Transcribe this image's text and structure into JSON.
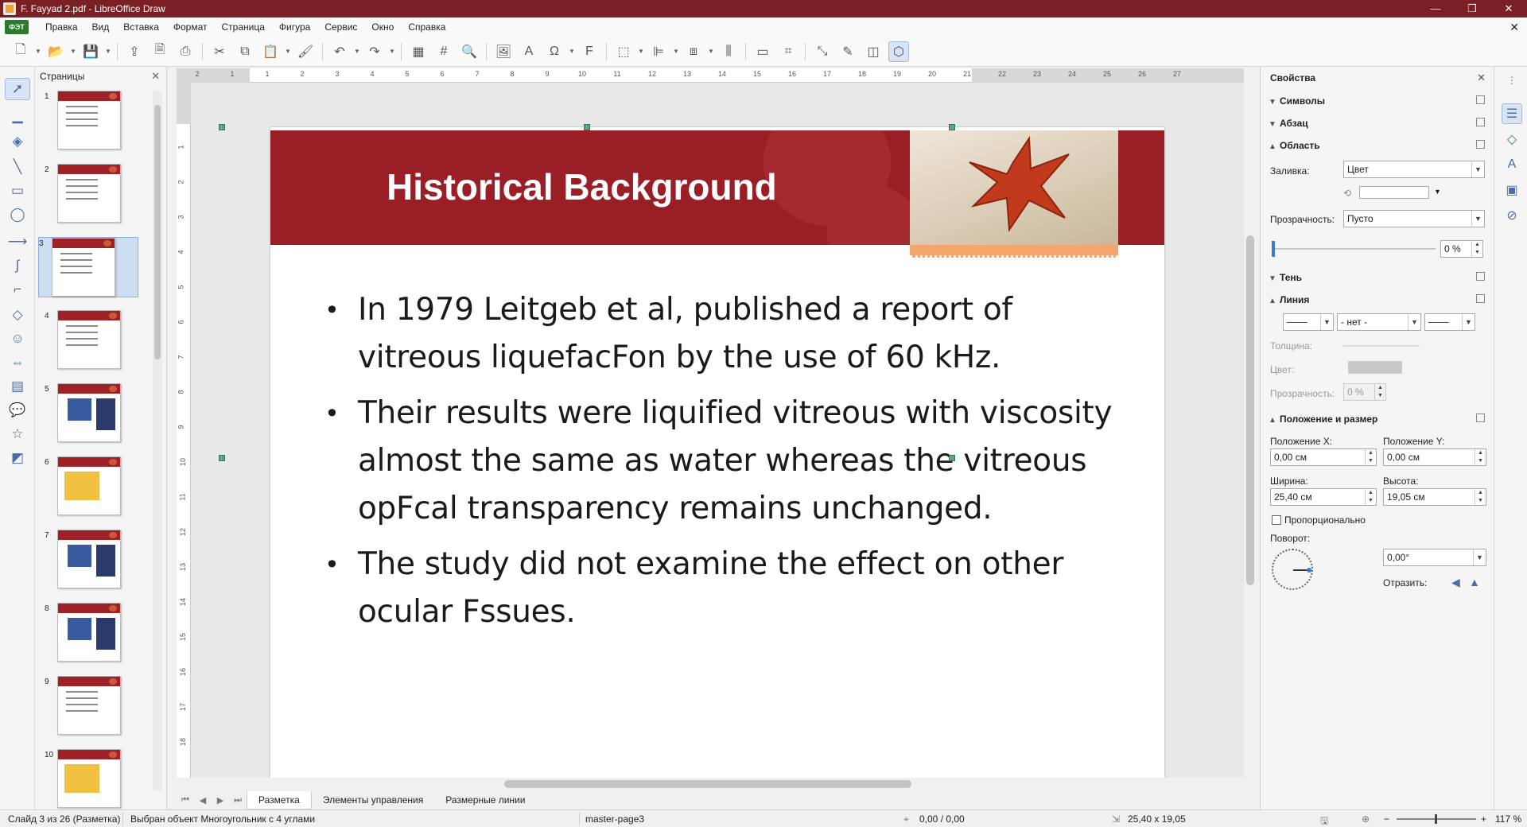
{
  "window": {
    "title": "F. Fayyad 2.pdf - LibreOffice Draw",
    "controls": [
      "—",
      "❐",
      "✕"
    ]
  },
  "menubar": {
    "logo": "ФЭТ",
    "items": [
      "Правка",
      "Вид",
      "Вставка",
      "Формат",
      "Страница",
      "Фигура",
      "Сервис",
      "Окно",
      "Справка"
    ],
    "close_doc": "✕"
  },
  "toolbar": {
    "icons": [
      "new-icon",
      "open-icon",
      "save-icon",
      "export-icon",
      "export-pdf-icon",
      "print-icon",
      "cut-icon",
      "copy-icon",
      "paste-icon",
      "clone-format-icon",
      "undo-icon",
      "redo-icon",
      "grid-icon",
      "helplines-icon",
      "zoom-icon",
      "image-icon",
      "textbox-icon",
      "special-char-icon",
      "fontwork-icon",
      "transform-icon",
      "align-icon",
      "arrange-icon",
      "distribute-icon",
      "shadow-icon",
      "crop-icon",
      "points-icon",
      "glue-icon",
      "toggle-extrusion-icon",
      "show-draw-icon"
    ]
  },
  "slides_pane": {
    "title": "Страницы",
    "close": "✕",
    "slides": [
      {
        "num": "1",
        "kind": "text"
      },
      {
        "num": "2",
        "kind": "text"
      },
      {
        "num": "3",
        "kind": "text",
        "selected": true
      },
      {
        "num": "4",
        "kind": "text"
      },
      {
        "num": "5",
        "kind": "images"
      },
      {
        "num": "6",
        "kind": "yellow"
      },
      {
        "num": "7",
        "kind": "images"
      },
      {
        "num": "8",
        "kind": "images"
      },
      {
        "num": "9",
        "kind": "text"
      },
      {
        "num": "10",
        "kind": "yellow"
      }
    ]
  },
  "ruler": {
    "h_ticks": [
      "2",
      "1",
      "1",
      "2",
      "3",
      "4",
      "5",
      "6",
      "7",
      "8",
      "9",
      "10",
      "11",
      "12",
      "13",
      "14",
      "15",
      "16",
      "17",
      "18",
      "19",
      "20",
      "21",
      "22",
      "23",
      "24",
      "25",
      "26",
      "27"
    ],
    "v_ticks": [
      "1",
      "2",
      "3",
      "4",
      "5",
      "6",
      "7",
      "8",
      "9",
      "10",
      "11",
      "12",
      "13",
      "14",
      "15",
      "16",
      "17",
      "18"
    ]
  },
  "slide": {
    "heading": "Historical Background",
    "bullets": [
      "In 1979 Leitgeb et al, published a report of vitreous liquefacFon by the use of 60 kHz.",
      "Their results were liquified vitreous with viscosity almost the same as water whereas the vitreous opFcal transparency remains unchanged.",
      "The study did not examine the effect on other ocular Fssues."
    ],
    "colors": {
      "banner": "#9a1e26",
      "scallop": "#f5a66e"
    }
  },
  "tabs": {
    "items": [
      "Разметка",
      "Элементы управления",
      "Размерные линии"
    ],
    "active": 0
  },
  "sidebar": {
    "title": "Свойства",
    "close": "✕",
    "sections": {
      "symbols": "Символы",
      "paragraph": "Абзац",
      "area": "Область",
      "shadow": "Тень",
      "line": "Линия",
      "position": "Положение и размер"
    },
    "area": {
      "fill_label": "Заливка:",
      "fill_value": "Цвет",
      "transparency_label": "Прозрачность:",
      "transparency_value": "Пусто",
      "transparency_percent": "0 %",
      "transparency_level": 0
    },
    "line": {
      "style_value": "- нет -",
      "thickness_label": "Толщина:",
      "color_label": "Цвет:",
      "transparency_label": "Прозрачность:",
      "transparency_value": "0 %"
    },
    "position": {
      "pos_x_label": "Положение X:",
      "pos_x_value": "0,00 см",
      "pos_y_label": "Положение Y:",
      "pos_y_value": "0,00 см",
      "width_label": "Ширина:",
      "width_value": "25,40 см",
      "height_label": "Высота:",
      "height_value": "19,05 см",
      "proportional_label": "Пропорционально",
      "rotation_label": "Поворот:",
      "rotation_value": "0,00°",
      "flip_label": "Отразить:"
    }
  },
  "statusbar": {
    "slide_info": "Слайд 3 из 26 (Разметка)",
    "selection": "Выбран объект Многоугольник с 4 углами",
    "master": "master-page3",
    "position": "0,00 / 0,00",
    "size": "25,40 x 19,05",
    "zoom": "117 %"
  }
}
